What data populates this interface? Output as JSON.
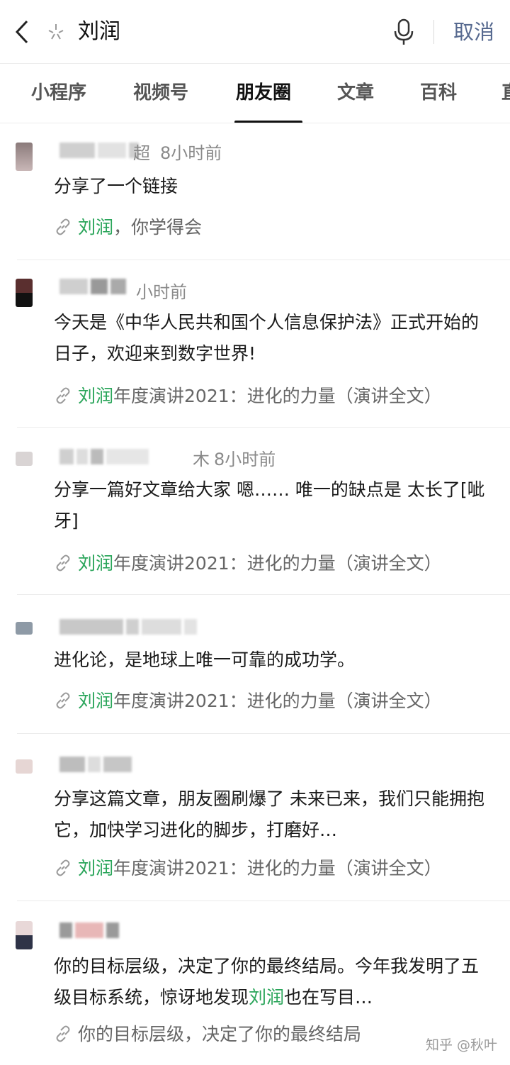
{
  "search": {
    "query": "刘润",
    "cancel_label": "取消"
  },
  "tabs": [
    {
      "label": "小程序"
    },
    {
      "label": "视频号"
    },
    {
      "label": "朋友圈",
      "active": true
    },
    {
      "label": "文章"
    },
    {
      "label": "百科"
    },
    {
      "label": "直"
    }
  ],
  "posts": [
    {
      "name_visible": "超",
      "time": "8小时前",
      "text": "分享了一个链接",
      "link_keyword": "刘润",
      "link_rest": "，你学得会"
    },
    {
      "name_visible": "",
      "time": "小时前",
      "text": "今天是《中华人民共和国个人信息保护法》正式开始的日子，欢迎来到数字世界!",
      "link_keyword": "刘润",
      "link_rest": "年度演讲2021：进化的力量（演讲全文）"
    },
    {
      "name_visible": "木",
      "time": "8小时前",
      "text": "分享一篇好文章给大家 嗯…… 唯一的缺点是 太长了[呲牙]",
      "link_keyword": "刘润",
      "link_rest": "年度演讲2021：进化的力量（演讲全文）"
    },
    {
      "name_visible": "",
      "time": "",
      "text": "进化论，是地球上唯一可靠的成功学。",
      "link_keyword": "刘润",
      "link_rest": "年度演讲2021：进化的力量（演讲全文）"
    },
    {
      "name_visible": "",
      "time": "",
      "text": "分享这篇文章，朋友圈刷爆了 未来已来，我们只能拥抱它，加快学习进化的脚步，打磨好…",
      "link_keyword": "刘润",
      "link_rest": "年度演讲2021：进化的力量（演讲全文）"
    },
    {
      "name_visible": "",
      "time": "",
      "text_before": "你的目标层级，决定了你的最终结局。今年我发明了五级目标系统，惊讶地发现",
      "text_keyword": "刘润",
      "text_after": "也在写目…",
      "link_keyword": "",
      "link_rest": "你的目标层级，决定了你的最终结局"
    }
  ],
  "watermark": "知乎 @秋叶",
  "colors": {
    "highlight": "#2aa55a",
    "cancel": "#56698f"
  }
}
